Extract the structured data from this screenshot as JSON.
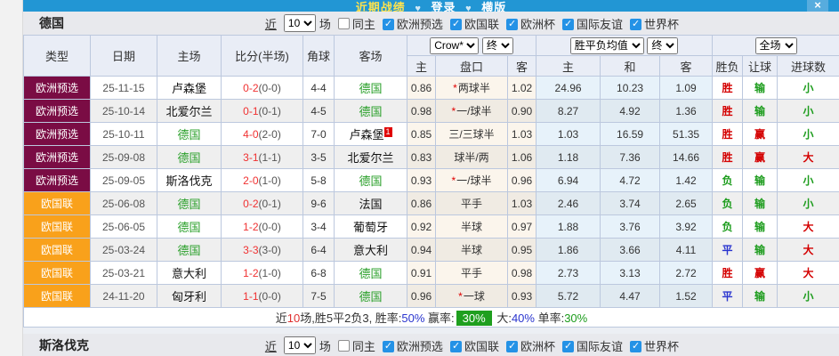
{
  "top_bar": {
    "brand": "近期战绩",
    "sep": "♥",
    "login": "登录",
    "layout": "横版",
    "close": "×"
  },
  "filter": {
    "team": "德国",
    "near": "近",
    "count": "10",
    "unit": "场",
    "same_home": "同主",
    "competitions": [
      "欧洲预选",
      "欧国联",
      "欧洲杯",
      "国际友谊",
      "世界杯"
    ]
  },
  "table": {
    "left_headers": [
      "类型",
      "日期",
      "主场",
      "比分(半场)",
      "角球",
      "客场"
    ],
    "sub_headers": [
      "主",
      "盘口",
      "客",
      "主",
      "和",
      "客",
      "胜负",
      "让球",
      "进球数"
    ],
    "dropdowns": {
      "company": "Crow*",
      "company_period": "终",
      "avg": "胜平负均值",
      "avg_period": "终",
      "scope": "全场"
    },
    "league_colors": {
      "欧洲预选": "#7A0C44",
      "欧国联": "#F9A11B"
    },
    "outcome_colors": {
      "胜": "#D40000",
      "平": "#2A35CF",
      "负": "#1C9C1C",
      "赢": "#D40000",
      "输": "#1C9C1C",
      "大": "#D40000",
      "小": "#1C9C1C"
    },
    "rows": [
      {
        "league": "欧洲预选",
        "date": "25-11-15",
        "home": "卢森堡",
        "home_green": false,
        "score": "0-2",
        "half": "(0-0)",
        "corners": "4-4",
        "away": "德国",
        "away_green": true,
        "away_red_card": "",
        "odds_home": "0.86",
        "star": true,
        "handicap": "两球半",
        "odds_away": "1.02",
        "avg_win": "24.96",
        "avg_draw": "10.23",
        "avg_lose": "1.09",
        "result": "胜",
        "handicap_result": "输",
        "goals": "小"
      },
      {
        "league": "欧洲预选",
        "date": "25-10-14",
        "home": "北爱尔兰",
        "home_green": false,
        "score": "0-1",
        "half": "(0-1)",
        "corners": "4-5",
        "away": "德国",
        "away_green": true,
        "away_red_card": "",
        "odds_home": "0.98",
        "star": true,
        "handicap": "一/球半",
        "odds_away": "0.90",
        "avg_win": "8.27",
        "avg_draw": "4.92",
        "avg_lose": "1.36",
        "result": "胜",
        "handicap_result": "输",
        "goals": "小"
      },
      {
        "league": "欧洲预选",
        "date": "25-10-11",
        "home": "德国",
        "home_green": true,
        "score": "4-0",
        "half": "(2-0)",
        "corners": "7-0",
        "away": "卢森堡",
        "away_green": false,
        "away_red_card": "1",
        "odds_home": "0.85",
        "star": false,
        "handicap": "三/三球半",
        "odds_away": "1.03",
        "avg_win": "1.03",
        "avg_draw": "16.59",
        "avg_lose": "51.35",
        "result": "胜",
        "handicap_result": "赢",
        "goals": "小"
      },
      {
        "league": "欧洲预选",
        "date": "25-09-08",
        "home": "德国",
        "home_green": true,
        "score": "3-1",
        "half": "(1-1)",
        "corners": "3-5",
        "away": "北爱尔兰",
        "away_green": false,
        "away_red_card": "",
        "odds_home": "0.83",
        "star": false,
        "handicap": "球半/两",
        "odds_away": "1.06",
        "avg_win": "1.18",
        "avg_draw": "7.36",
        "avg_lose": "14.66",
        "result": "胜",
        "handicap_result": "赢",
        "goals": "大"
      },
      {
        "league": "欧洲预选",
        "date": "25-09-05",
        "home": "斯洛伐克",
        "home_green": false,
        "score": "2-0",
        "half": "(1-0)",
        "corners": "5-8",
        "away": "德国",
        "away_green": true,
        "away_red_card": "",
        "odds_home": "0.93",
        "star": true,
        "handicap": "一/球半",
        "odds_away": "0.96",
        "avg_win": "6.94",
        "avg_draw": "4.72",
        "avg_lose": "1.42",
        "result": "负",
        "handicap_result": "输",
        "goals": "小"
      },
      {
        "league": "欧国联",
        "date": "25-06-08",
        "home": "德国",
        "home_green": true,
        "score": "0-2",
        "half": "(0-1)",
        "corners": "9-6",
        "away": "法国",
        "away_green": false,
        "away_red_card": "",
        "odds_home": "0.86",
        "star": false,
        "handicap": "平手",
        "odds_away": "1.03",
        "avg_win": "2.46",
        "avg_draw": "3.74",
        "avg_lose": "2.65",
        "result": "负",
        "handicap_result": "输",
        "goals": "小"
      },
      {
        "league": "欧国联",
        "date": "25-06-05",
        "home": "德国",
        "home_green": true,
        "score": "1-2",
        "half": "(0-0)",
        "corners": "3-4",
        "away": "葡萄牙",
        "away_green": false,
        "away_red_card": "",
        "odds_home": "0.92",
        "star": false,
        "handicap": "半球",
        "odds_away": "0.97",
        "avg_win": "1.88",
        "avg_draw": "3.76",
        "avg_lose": "3.92",
        "result": "负",
        "handicap_result": "输",
        "goals": "大"
      },
      {
        "league": "欧国联",
        "date": "25-03-24",
        "home": "德国",
        "home_green": true,
        "score": "3-3",
        "half": "(3-0)",
        "corners": "6-4",
        "away": "意大利",
        "away_green": false,
        "away_red_card": "",
        "odds_home": "0.94",
        "star": false,
        "handicap": "半球",
        "odds_away": "0.95",
        "avg_win": "1.86",
        "avg_draw": "3.66",
        "avg_lose": "4.11",
        "result": "平",
        "handicap_result": "输",
        "goals": "大"
      },
      {
        "league": "欧国联",
        "date": "25-03-21",
        "home": "意大利",
        "home_green": false,
        "score": "1-2",
        "half": "(1-0)",
        "corners": "6-8",
        "away": "德国",
        "away_green": true,
        "away_red_card": "",
        "odds_home": "0.91",
        "star": false,
        "handicap": "平手",
        "odds_away": "0.98",
        "avg_win": "2.73",
        "avg_draw": "3.13",
        "avg_lose": "2.72",
        "result": "胜",
        "handicap_result": "赢",
        "goals": "大"
      },
      {
        "league": "欧国联",
        "date": "24-11-20",
        "home": "匈牙利",
        "home_green": false,
        "score": "1-1",
        "half": "(0-0)",
        "corners": "7-5",
        "away": "德国",
        "away_green": true,
        "away_red_card": "",
        "odds_home": "0.96",
        "star": true,
        "handicap": "一球",
        "odds_away": "0.93",
        "avg_win": "5.72",
        "avg_draw": "4.47",
        "avg_lose": "1.52",
        "result": "平",
        "handicap_result": "输",
        "goals": "小"
      }
    ]
  },
  "summary": {
    "near": "近",
    "count": "10",
    "record": "场,胜5平2负3, 胜率:",
    "win_rate": "50%",
    "label_win": " 赢率:",
    "win_badge": "30%",
    "label_big": " 大:",
    "big_rate": "40%",
    "label_single": " 单率:",
    "single_rate": "30%"
  },
  "section2": {
    "team": "斯洛伐克",
    "near": "近",
    "count": "10",
    "unit": "场",
    "same_home": "同主",
    "competitions": [
      "欧洲预选",
      "欧国联",
      "欧洲杯",
      "国际友谊",
      "世界杯"
    ]
  }
}
